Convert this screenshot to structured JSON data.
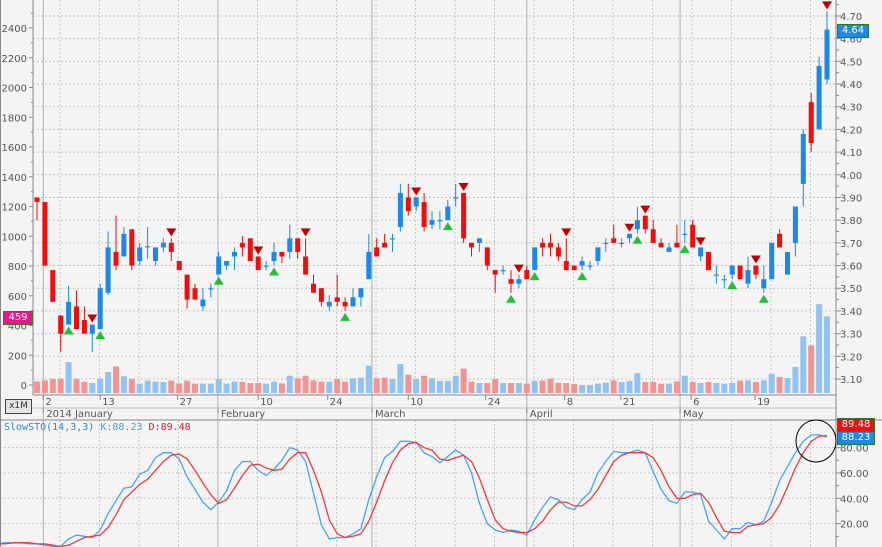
{
  "chart_data": {
    "type": "candlestick",
    "symbol_period": "x1M",
    "price_axis": {
      "min": 3.1,
      "max": 4.7,
      "step": 0.1,
      "labels": [
        "3.10",
        "3.20",
        "3.30",
        "3.40",
        "3.50",
        "3.60",
        "3.70",
        "3.80",
        "3.90",
        "4.00",
        "4.10",
        "4.20",
        "4.30",
        "4.40",
        "4.50",
        "4.60",
        "4.70"
      ]
    },
    "volume_axis": {
      "min": 0,
      "max": 2400,
      "labels": [
        "0",
        "200",
        "400",
        "600",
        "800",
        "1000",
        "1200",
        "1400",
        "1600",
        "1800",
        "2000",
        "2200",
        "2400"
      ]
    },
    "last_price": "4.64",
    "left_marker": "459",
    "colors": {
      "up": "#1e88e5",
      "down": "#f20d0d",
      "vol_up": "#92c3f0",
      "vol_down": "#f29494",
      "k": "#4aa3f0",
      "d": "#f03a3a",
      "buy_signal": "#22c03a",
      "sell_signal": "#c00000",
      "marker": "#e8178a"
    },
    "ohlc": [
      [
        3.9,
        3.9,
        3.8,
        3.88
      ],
      [
        3.88,
        3.88,
        3.6,
        3.6
      ],
      [
        3.58,
        3.58,
        3.44,
        3.44
      ],
      [
        3.38,
        3.38,
        3.22,
        3.3
      ],
      [
        3.34,
        3.51,
        3.34,
        3.44
      ],
      [
        3.42,
        3.49,
        3.32,
        3.32
      ],
      [
        3.36,
        3.42,
        3.3,
        3.3
      ],
      [
        3.3,
        3.34,
        3.22,
        3.34
      ],
      [
        3.32,
        3.52,
        3.32,
        3.5
      ],
      [
        3.48,
        3.75,
        3.47,
        3.68
      ],
      [
        3.66,
        3.82,
        3.58,
        3.6
      ],
      [
        3.64,
        3.77,
        3.64,
        3.74
      ],
      [
        3.76,
        3.76,
        3.58,
        3.6
      ],
      [
        3.62,
        3.7,
        3.6,
        3.68
      ],
      [
        3.68,
        3.77,
        3.63,
        3.685
      ],
      [
        3.62,
        3.68,
        3.6,
        3.68
      ],
      [
        3.68,
        3.72,
        3.66,
        3.7
      ],
      [
        3.7,
        3.72,
        3.62,
        3.66
      ],
      [
        3.62,
        3.62,
        3.58,
        3.58
      ],
      [
        3.56,
        3.56,
        3.41,
        3.45
      ],
      [
        3.5,
        3.52,
        3.45,
        3.45
      ],
      [
        3.42,
        3.5,
        3.4,
        3.45
      ],
      [
        3.495,
        3.52,
        3.46,
        3.5
      ],
      [
        3.56,
        3.66,
        3.56,
        3.64
      ],
      [
        3.6,
        3.62,
        3.58,
        3.62
      ],
      [
        3.64,
        3.68,
        3.58,
        3.66
      ],
      [
        3.7,
        3.73,
        3.64,
        3.68
      ],
      [
        3.72,
        3.72,
        3.62,
        3.62
      ],
      [
        3.64,
        3.64,
        3.58,
        3.58
      ],
      [
        3.595,
        3.62,
        3.58,
        3.6
      ],
      [
        3.62,
        3.7,
        3.6,
        3.66
      ],
      [
        3.66,
        3.66,
        3.61,
        3.64
      ],
      [
        3.66,
        3.78,
        3.63,
        3.72
      ],
      [
        3.72,
        3.72,
        3.63,
        3.66
      ],
      [
        3.64,
        3.72,
        3.56,
        3.56
      ],
      [
        3.52,
        3.56,
        3.48,
        3.48
      ],
      [
        3.5,
        3.5,
        3.42,
        3.44
      ],
      [
        3.42,
        3.47,
        3.4,
        3.44
      ],
      [
        3.46,
        3.56,
        3.42,
        3.44
      ],
      [
        3.44,
        3.46,
        3.4,
        3.42
      ],
      [
        3.42,
        3.5,
        3.42,
        3.46
      ],
      [
        3.46,
        3.5,
        3.42,
        3.5
      ],
      [
        3.54,
        3.74,
        3.54,
        3.66
      ],
      [
        3.68,
        3.72,
        3.64,
        3.64
      ],
      [
        3.7,
        3.74,
        3.68,
        3.68
      ],
      [
        3.715,
        3.74,
        3.66,
        3.72
      ],
      [
        3.77,
        3.96,
        3.75,
        3.92
      ],
      [
        3.9,
        3.96,
        3.82,
        3.84
      ],
      [
        3.86,
        3.9,
        3.84,
        3.9
      ],
      [
        3.88,
        3.92,
        3.75,
        3.77
      ],
      [
        3.78,
        3.84,
        3.76,
        3.8
      ],
      [
        3.795,
        3.84,
        3.76,
        3.8
      ],
      [
        3.8,
        3.89,
        3.8,
        3.86
      ],
      [
        3.895,
        3.96,
        3.86,
        3.9
      ],
      [
        3.92,
        3.92,
        3.7,
        3.72
      ],
      [
        3.7,
        3.7,
        3.64,
        3.68
      ],
      [
        3.7,
        3.72,
        3.66,
        3.72
      ],
      [
        3.68,
        3.68,
        3.58,
        3.6
      ],
      [
        3.58,
        3.58,
        3.48,
        3.56
      ],
      [
        3.575,
        3.6,
        3.56,
        3.58
      ],
      [
        3.54,
        3.58,
        3.48,
        3.52
      ],
      [
        3.52,
        3.56,
        3.5,
        3.54
      ],
      [
        3.58,
        3.6,
        3.54,
        3.54
      ],
      [
        3.58,
        3.68,
        3.58,
        3.68
      ],
      [
        3.7,
        3.72,
        3.64,
        3.68
      ],
      [
        3.7,
        3.74,
        3.64,
        3.68
      ],
      [
        3.68,
        3.7,
        3.62,
        3.64
      ],
      [
        3.62,
        3.72,
        3.58,
        3.58
      ],
      [
        3.6,
        3.6,
        3.58,
        3.58
      ],
      [
        3.6,
        3.64,
        3.58,
        3.62
      ],
      [
        3.595,
        3.62,
        3.58,
        3.6
      ],
      [
        3.62,
        3.68,
        3.6,
        3.68
      ],
      [
        3.695,
        3.72,
        3.66,
        3.7
      ],
      [
        3.72,
        3.78,
        3.7,
        3.7
      ],
      [
        3.695,
        3.72,
        3.68,
        3.7
      ],
      [
        3.72,
        3.74,
        3.7,
        3.74
      ],
      [
        3.76,
        3.86,
        3.74,
        3.8
      ],
      [
        3.82,
        3.82,
        3.74,
        3.76
      ],
      [
        3.76,
        3.8,
        3.7,
        3.7
      ],
      [
        3.7,
        3.72,
        3.68,
        3.68
      ],
      [
        3.66,
        3.7,
        3.66,
        3.68
      ],
      [
        3.7,
        3.78,
        3.68,
        3.68
      ],
      [
        3.735,
        3.8,
        3.7,
        3.74
      ],
      [
        3.78,
        3.8,
        3.68,
        3.68
      ],
      [
        3.64,
        3.68,
        3.62,
        3.68
      ],
      [
        3.66,
        3.66,
        3.58,
        3.58
      ],
      [
        3.555,
        3.6,
        3.52,
        3.56
      ],
      [
        3.535,
        3.56,
        3.5,
        3.54
      ],
      [
        3.56,
        3.6,
        3.54,
        3.6
      ],
      [
        3.6,
        3.6,
        3.54,
        3.54
      ],
      [
        3.52,
        3.64,
        3.5,
        3.58
      ],
      [
        3.6,
        3.6,
        3.54,
        3.56
      ],
      [
        3.5,
        3.6,
        3.48,
        3.54
      ],
      [
        3.54,
        3.7,
        3.54,
        3.7
      ],
      [
        3.74,
        3.76,
        3.68,
        3.68
      ],
      [
        3.56,
        3.66,
        3.56,
        3.66
      ],
      [
        3.7,
        3.86,
        3.64,
        3.86
      ],
      [
        3.96,
        4.2,
        3.86,
        4.18
      ],
      [
        4.32,
        4.36,
        4.1,
        4.14
      ],
      [
        4.2,
        4.52,
        4.2,
        4.48
      ],
      [
        4.42,
        4.72,
        4.4,
        4.64
      ]
    ],
    "volume": [
      78,
      85,
      94,
      96,
      208,
      96,
      76,
      67,
      96,
      141,
      179,
      112,
      94,
      63,
      83,
      76,
      74,
      83,
      65,
      83,
      63,
      63,
      63,
      94,
      63,
      76,
      74,
      67,
      67,
      63,
      76,
      65,
      116,
      99,
      116,
      85,
      76,
      76,
      94,
      76,
      99,
      103,
      184,
      99,
      103,
      94,
      195,
      123,
      94,
      116,
      99,
      81,
      81,
      116,
      164,
      76,
      67,
      67,
      94,
      67,
      67,
      67,
      63,
      81,
      85,
      96,
      69,
      67,
      60,
      54,
      54,
      63,
      69,
      85,
      74,
      81,
      134,
      74,
      74,
      63,
      63,
      78,
      116,
      74,
      67,
      74,
      67,
      63,
      67,
      83,
      85,
      74,
      85,
      129,
      108,
      101,
      175,
      381,
      320,
      597,
      515
    ],
    "sell_signals": [
      8,
      18,
      29,
      35,
      49,
      55,
      62,
      68,
      76,
      78,
      85,
      92,
      101
    ],
    "buy_signals": [
      5,
      9,
      24,
      31,
      40,
      53,
      61,
      64,
      70,
      77,
      83,
      89,
      93
    ],
    "x_day_ticks": [
      {
        "label": "2",
        "index": 1.8
      },
      {
        "label": "13",
        "index": 9
      },
      {
        "label": "27",
        "index": 18.8
      },
      {
        "label": "10",
        "index": 29
      },
      {
        "label": "24",
        "index": 37.8
      },
      {
        "label": "10",
        "index": 48
      },
      {
        "label": "24",
        "index": 57.8
      },
      {
        "label": "8",
        "index": 67.8
      },
      {
        "label": "21",
        "index": 74.9
      },
      {
        "label": "6",
        "index": 83.8
      },
      {
        "label": "19",
        "index": 91.9
      }
    ],
    "x_month_ticks": [
      {
        "label": "2014 January",
        "index": 1.8
      },
      {
        "label": "February",
        "index": 23.9
      },
      {
        "label": "March",
        "index": 43.4
      },
      {
        "label": "April",
        "index": 63
      },
      {
        "label": "May",
        "index": 82.4
      }
    ],
    "indicator": {
      "name": "SlowSTO(14,3,3)",
      "k_label": "K:88.23",
      "d_label": "D:89.48",
      "k_value": "88.23",
      "d_value": "89.48",
      "axis_labels": [
        "20.00",
        "40.00",
        "60.00",
        "80.00"
      ],
      "start_index": -4,
      "k": [
        4,
        5,
        5,
        5,
        4,
        4,
        3,
        2,
        2,
        8,
        11,
        10,
        9,
        15,
        28,
        38,
        48,
        49,
        59,
        62,
        72,
        76,
        76,
        71,
        57,
        47,
        37,
        31,
        37,
        46,
        62,
        69,
        69,
        62,
        58,
        63,
        70,
        80,
        78,
        69,
        44,
        19,
        8,
        9,
        9,
        12,
        16,
        39,
        57,
        72,
        77,
        85,
        85,
        84,
        76,
        73,
        68,
        73,
        78,
        74,
        60,
        36,
        20,
        15,
        13,
        15,
        14,
        11,
        23,
        33,
        41,
        39,
        33,
        31,
        39,
        45,
        60,
        69,
        77,
        76,
        76,
        78,
        76,
        61,
        47,
        38,
        36,
        45,
        45,
        43,
        22,
        15,
        8,
        16,
        16,
        21,
        19,
        22,
        37,
        54,
        65,
        76,
        85,
        90,
        90,
        88.23
      ],
      "d": [
        4,
        4,
        5,
        5,
        5,
        4,
        4,
        3,
        2,
        3,
        6,
        9,
        10,
        11,
        17,
        27,
        39,
        45,
        51,
        55,
        62,
        69,
        74,
        75,
        71,
        62,
        52,
        43,
        36,
        39,
        48,
        58,
        66,
        67,
        64,
        62,
        63,
        71,
        76,
        76,
        62,
        45,
        23,
        12,
        9,
        10,
        12,
        22,
        37,
        54,
        68,
        78,
        83,
        84,
        80,
        78,
        71,
        70,
        72,
        74,
        69,
        56,
        39,
        23,
        16,
        14,
        13,
        13,
        16,
        22,
        31,
        37,
        37,
        34,
        34,
        39,
        47,
        58,
        69,
        74,
        76,
        76,
        76,
        72,
        62,
        49,
        40,
        40,
        43,
        44,
        37,
        25,
        14,
        13,
        13,
        18,
        19,
        20,
        25,
        35,
        49,
        64,
        76,
        85,
        89,
        89.48
      ]
    }
  }
}
